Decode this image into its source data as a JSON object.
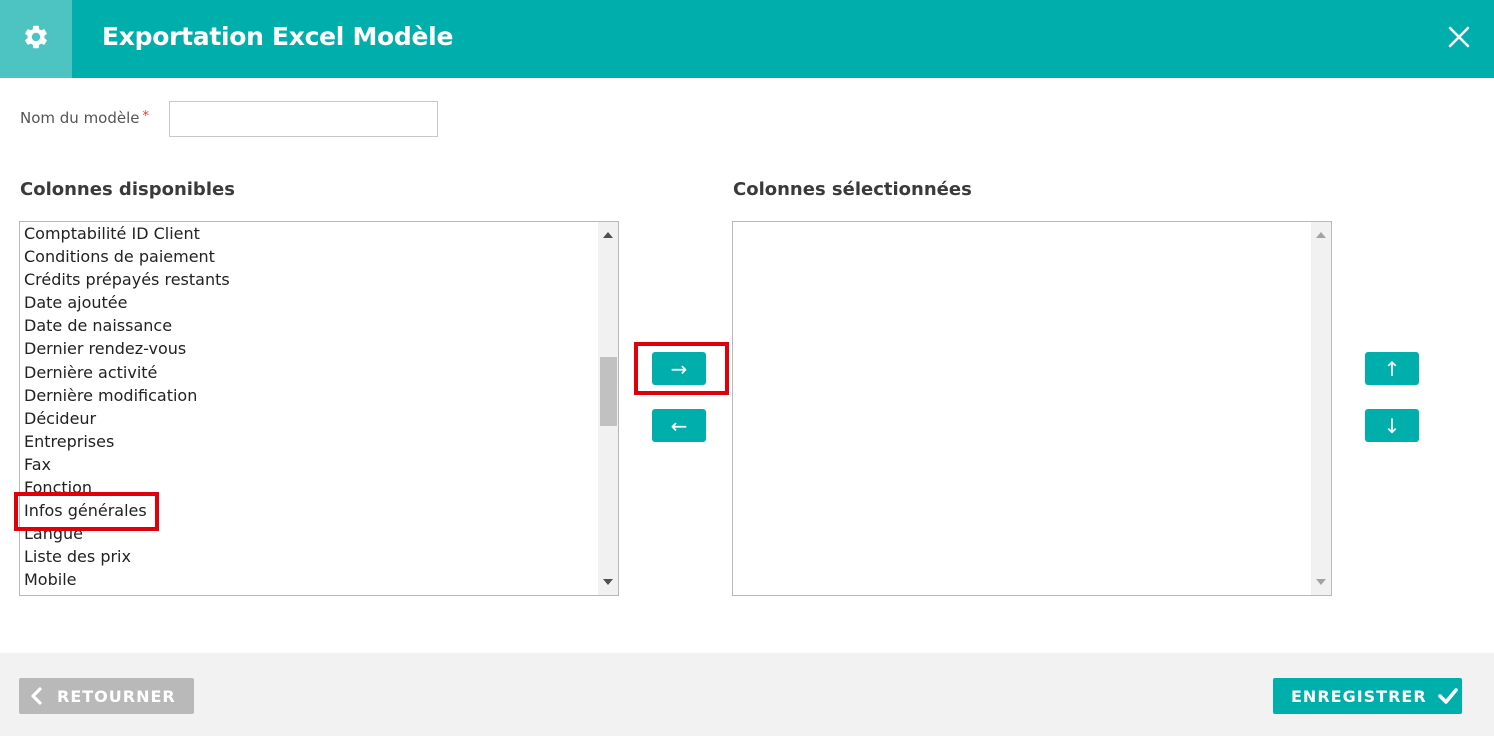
{
  "header": {
    "title": "Exportation Excel Modèle",
    "settings_icon": "gear-icon",
    "close_icon": "close-icon",
    "background_color": "#00aeab"
  },
  "form": {
    "name_label": "Nom du modèle",
    "required_marker": "*",
    "name_value": ""
  },
  "available": {
    "title": "Colonnes disponibles",
    "items": [
      "Comptabilité ID Client",
      "Conditions de paiement",
      "Crédits prépayés restants",
      "Date ajoutée",
      "Date de naissance",
      "Dernier rendez-vous",
      "Dernière activité",
      "Dernière modification",
      "Décideur",
      "Entreprises",
      "Fax",
      "Fonction",
      "Infos générales",
      "Langue",
      "Liste des prix",
      "Mobile"
    ]
  },
  "selected": {
    "title": "Colonnes sélectionnées",
    "items": []
  },
  "transfer": {
    "add_label": "→",
    "remove_label": "←",
    "move_up_label": "↑",
    "move_down_label": "↓"
  },
  "footer": {
    "back_label": "RETOURNER",
    "save_label": "ENREGISTRER",
    "back_icon": "chevron-left-icon",
    "save_icon": "check-icon"
  },
  "colors": {
    "accent": "#00aeab",
    "highlight": "#e0000b",
    "required": "#e53935"
  }
}
